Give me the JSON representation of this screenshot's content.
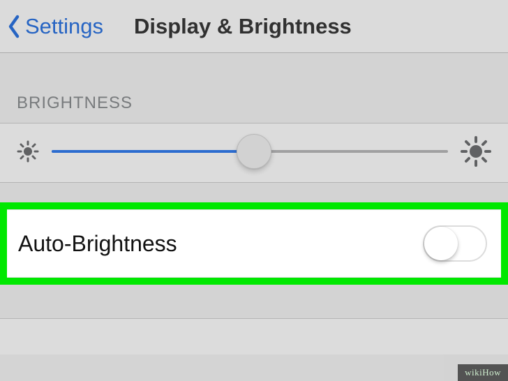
{
  "nav": {
    "back_label": "Settings",
    "title": "Display & Brightness"
  },
  "brightness": {
    "section_header": "BRIGHTNESS",
    "slider_percent": 51,
    "auto_brightness_label": "Auto-Brightness",
    "auto_brightness_on": false
  },
  "colors": {
    "accent": "#0e5dd6",
    "highlight": "#00e800"
  },
  "watermark": "wikiHow"
}
